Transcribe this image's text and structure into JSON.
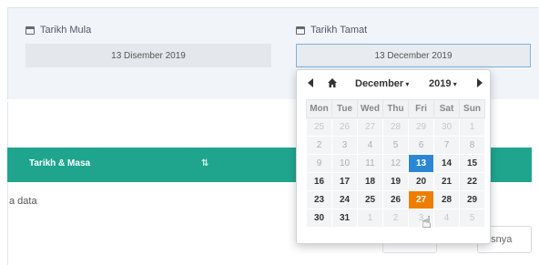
{
  "filter": {
    "start_label": "Tarikh Mula",
    "start_value": "13 Disember 2019",
    "end_label": "Tarikh Tamat",
    "end_value": "13 December 2019"
  },
  "table": {
    "header_label": "Tarikh & Masa",
    "sort_icon": "⇅",
    "empty_text": "a data"
  },
  "pagination": {
    "next_label": "usnya"
  },
  "datepicker": {
    "month": "December",
    "year": "2019",
    "weekdays": [
      "Mon",
      "Tue",
      "Wed",
      "Thu",
      "Fri",
      "Sat",
      "Sun"
    ],
    "weeks": [
      [
        {
          "d": "25",
          "s": "muted"
        },
        {
          "d": "26",
          "s": "muted"
        },
        {
          "d": "27",
          "s": "muted"
        },
        {
          "d": "28",
          "s": "muted"
        },
        {
          "d": "29",
          "s": "muted"
        },
        {
          "d": "30",
          "s": "muted"
        },
        {
          "d": "1",
          "s": "muted"
        }
      ],
      [
        {
          "d": "2",
          "s": "disabled"
        },
        {
          "d": "3",
          "s": "disabled"
        },
        {
          "d": "4",
          "s": "disabled"
        },
        {
          "d": "5",
          "s": "disabled"
        },
        {
          "d": "6",
          "s": "disabled"
        },
        {
          "d": "7",
          "s": "disabled"
        },
        {
          "d": "8",
          "s": "disabled"
        }
      ],
      [
        {
          "d": "9",
          "s": "disabled"
        },
        {
          "d": "10",
          "s": "disabled"
        },
        {
          "d": "11",
          "s": "disabled"
        },
        {
          "d": "12",
          "s": "disabled"
        },
        {
          "d": "13",
          "s": "selected"
        },
        {
          "d": "14",
          "s": ""
        },
        {
          "d": "15",
          "s": ""
        }
      ],
      [
        {
          "d": "16",
          "s": ""
        },
        {
          "d": "17",
          "s": ""
        },
        {
          "d": "18",
          "s": ""
        },
        {
          "d": "19",
          "s": ""
        },
        {
          "d": "20",
          "s": ""
        },
        {
          "d": "21",
          "s": ""
        },
        {
          "d": "22",
          "s": ""
        }
      ],
      [
        {
          "d": "23",
          "s": ""
        },
        {
          "d": "24",
          "s": ""
        },
        {
          "d": "25",
          "s": ""
        },
        {
          "d": "26",
          "s": ""
        },
        {
          "d": "27",
          "s": "hover"
        },
        {
          "d": "28",
          "s": ""
        },
        {
          "d": "29",
          "s": ""
        }
      ],
      [
        {
          "d": "30",
          "s": ""
        },
        {
          "d": "31",
          "s": ""
        },
        {
          "d": "1",
          "s": "muted"
        },
        {
          "d": "2",
          "s": "muted"
        },
        {
          "d": "3",
          "s": "muted"
        },
        {
          "d": "4",
          "s": "muted"
        },
        {
          "d": "5",
          "s": "muted"
        }
      ]
    ],
    "colors": {
      "selected": "#2b87d6",
      "hover": "#ef7d00",
      "table_header": "#1fa58e"
    }
  }
}
